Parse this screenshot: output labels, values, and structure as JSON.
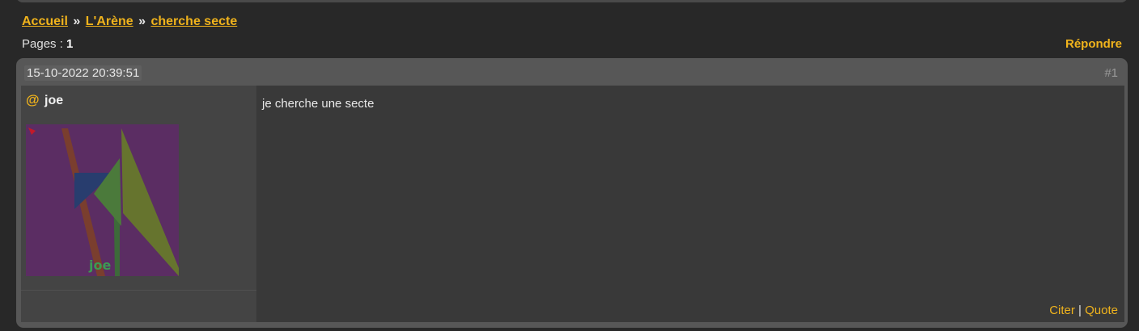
{
  "breadcrumb": {
    "items": [
      {
        "label": "Accueil"
      },
      {
        "label": "L'Arène"
      },
      {
        "label": "cherche secte"
      }
    ],
    "separator": "»"
  },
  "pagination": {
    "label": "Pages :",
    "current": "1"
  },
  "reply_label": "Répondre",
  "post": {
    "date": "15-10-2022 20:39:51",
    "number": "#1",
    "author": {
      "at_symbol": "@",
      "name": "joe",
      "avatar_text": "joe"
    },
    "message": "je cherche une secte",
    "actions": {
      "quote_fr": "Citer",
      "separator": "|",
      "quote_en": "Quote"
    }
  },
  "colors": {
    "accent": "#f0b31c",
    "background": "#282828",
    "post_frame": "#575757",
    "author_panel": "#444444",
    "message_panel": "#393939",
    "avatar_bg": "#5b2d63"
  }
}
